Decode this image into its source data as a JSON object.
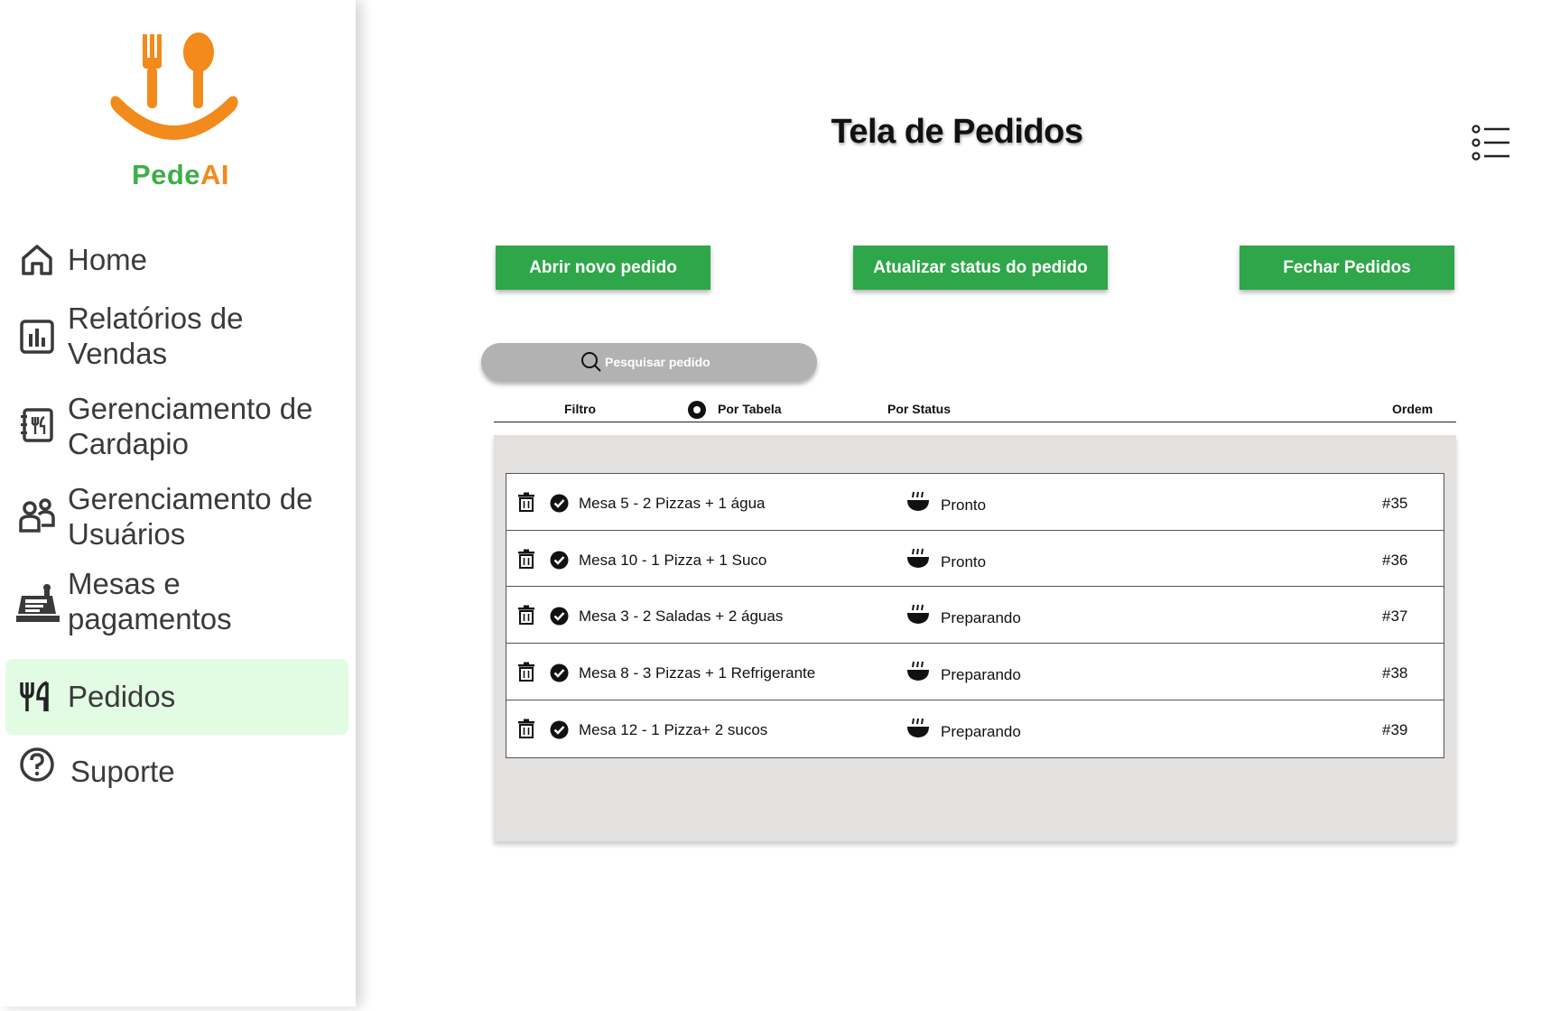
{
  "app": {
    "logo_part1": "Pede",
    "logo_part2": "AI",
    "brand_green": "#3fae49",
    "brand_orange": "#f28a1c"
  },
  "sidebar": {
    "items": [
      {
        "label": "Home",
        "icon": "home-icon"
      },
      {
        "label": "Relatórios de Vendas",
        "icon": "bar-chart-icon"
      },
      {
        "label": "Gerenciamento de Cardapio",
        "icon": "menu-book-icon"
      },
      {
        "label": "Gerenciamento de Usuários",
        "icon": "users-icon"
      },
      {
        "label": "Mesas e pagamentos",
        "icon": "cash-register-icon"
      },
      {
        "label": "Pedidos",
        "icon": "cutlery-icon",
        "active": true
      },
      {
        "label": "Suporte",
        "icon": "help-icon"
      }
    ]
  },
  "header": {
    "title": "Tela de Pedidos",
    "menu_icon": "list-icon"
  },
  "actions": {
    "new_order": "Abrir novo pedido",
    "update_status": "Atualizar status do pedido",
    "close_orders": "Fechar Pedidos",
    "accent": "#2fa64a"
  },
  "search": {
    "placeholder": "Pesquisar pedido"
  },
  "filters": {
    "label": "Filtro",
    "by_table": "Por Tabela",
    "by_status": "Por Status",
    "order": "Ordem"
  },
  "orders": [
    {
      "desc": "Mesa 5 - 2 Pizzas + 1 água",
      "status": "Pronto",
      "number": "#35"
    },
    {
      "desc": "Mesa 10 - 1 Pizza + 1 Suco",
      "status": "Pronto",
      "number": "#36"
    },
    {
      "desc": "Mesa 3 - 2 Saladas + 2 águas",
      "status": "Preparando",
      "number": "#37"
    },
    {
      "desc": "Mesa 8 - 3 Pizzas + 1 Refrigerante",
      "status": "Preparando",
      "number": "#38"
    },
    {
      "desc": "Mesa 12 - 1 Pizza+ 2 sucos",
      "status": "Preparando",
      "number": "#39"
    }
  ]
}
